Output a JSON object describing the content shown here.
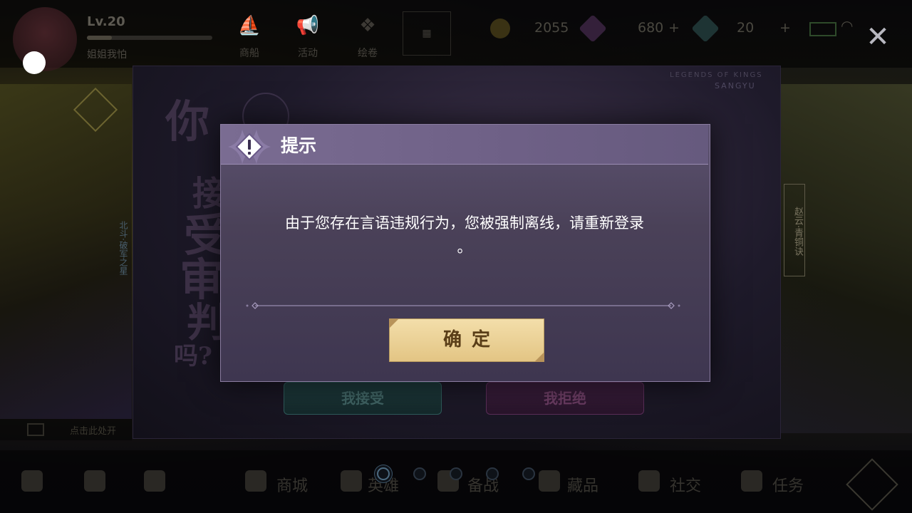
{
  "player": {
    "level": "Lv.20",
    "nickname": "姐姐我怕"
  },
  "top_nav": [
    {
      "label": "商船",
      "icon": "ship-icon"
    },
    {
      "label": "活动",
      "icon": "megaphone-icon"
    },
    {
      "label": "绘卷",
      "icon": "scroll-icon"
    }
  ],
  "resources": {
    "gold": "2055",
    "gems": "680",
    "tokens": "20"
  },
  "side_right_label": "赵云·青铜诀",
  "side_left_label": "北斗·破军之星",
  "chat_placeholder": "点击此处开",
  "event": {
    "brand_line1": "LEGENDS OF KINGS",
    "brand_line2": "SANGYU",
    "headline_chars": [
      "你",
      "接",
      "受",
      "审",
      "判",
      "吗?"
    ],
    "accept_label": "我接受",
    "reject_label": "我拒绝"
  },
  "dialog": {
    "title": "提示",
    "message_line1": "由于您存在言语违规行为，您被强制离线，请重新登录",
    "message_line2": "。",
    "confirm_label": "确定"
  },
  "bottom_nav": [
    {
      "label": "商城",
      "icon": "shop-icon"
    },
    {
      "label": "英雄",
      "icon": "hero-icon"
    },
    {
      "label": "备战",
      "icon": "prepare-icon"
    },
    {
      "label": "藏品",
      "icon": "collection-icon"
    },
    {
      "label": "社交",
      "icon": "social-icon"
    },
    {
      "label": "任务",
      "icon": "task-icon"
    }
  ],
  "colors": {
    "dialog_header": "#7a6c92",
    "confirm_button": "#f3deaa",
    "accent_text": "#5a3e18"
  }
}
